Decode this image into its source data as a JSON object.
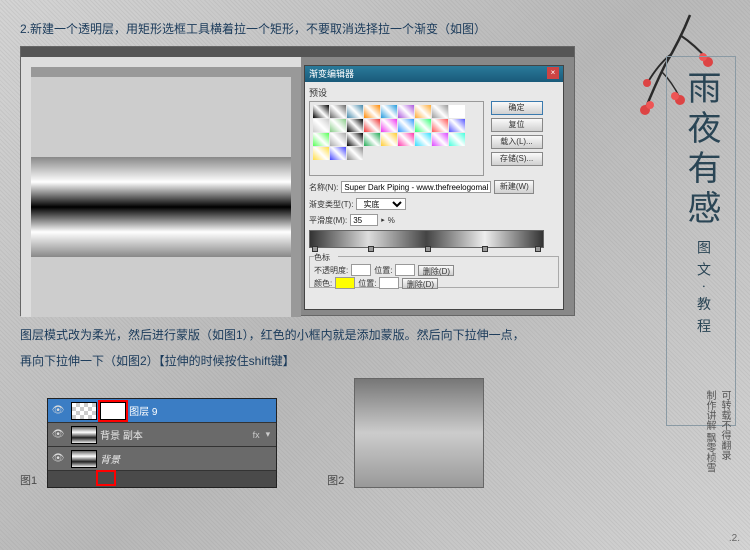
{
  "step2": "2.新建一个透明层，用矩形选框工具横着拉一个矩形，不要取消选择拉一个渐变（如图）",
  "step3a": "图层模式改为柔光，然后进行蒙版（如图1），红色的小框内就是添加蒙版。然后向下拉伸一点，",
  "step3b": "再向下拉伸一下（如图2）【拉伸的时候按住shift键】",
  "dialog": {
    "title": "渐变编辑器",
    "preset": "预设",
    "ok": "确定",
    "cancel": "复位",
    "load": "载入(L)...",
    "save": "存储(S)...",
    "new": "新建(W)",
    "name_lbl": "名称(N):",
    "name_val": "Super Dark Piping - www.thefreelogomakers...",
    "type_lbl": "渐变类型(T):",
    "type_val": "实底",
    "smooth_lbl": "平滑度(M):",
    "smooth_val": "35",
    "pct": "%",
    "stops_lbl": "色标",
    "opacity": "不透明度:",
    "loc": "位置:",
    "del": "删除(D)",
    "color": "颜色:"
  },
  "swatches": [
    [
      "#000",
      "#666",
      "#48a",
      "#f80",
      "#29d",
      "#a5d",
      "#fa3",
      "#999",
      "#fff",
      "#ccc"
    ],
    [
      "#8c8",
      "#000",
      "#e33",
      "#e3e",
      "#39f",
      "#3f7",
      "#f55",
      "#55f",
      "#5f5",
      "#aaa"
    ],
    [
      "#000",
      "#2a5",
      "#fc3",
      "#f3a",
      "#3df",
      "#d4f",
      "#4fd",
      "#fd4",
      "#44f",
      "#888"
    ]
  ],
  "layers": {
    "l9": "图层 9",
    "bg_copy": "背景 副本",
    "bg": "背景",
    "fx": "fx"
  },
  "fig1": "图1",
  "fig2": "图2",
  "title": "雨夜有感",
  "subtitle": "图文·教程",
  "credit1": "可转载不得翻录",
  "credit2": "制作讲解 飘零桢雪",
  "page": ".2."
}
